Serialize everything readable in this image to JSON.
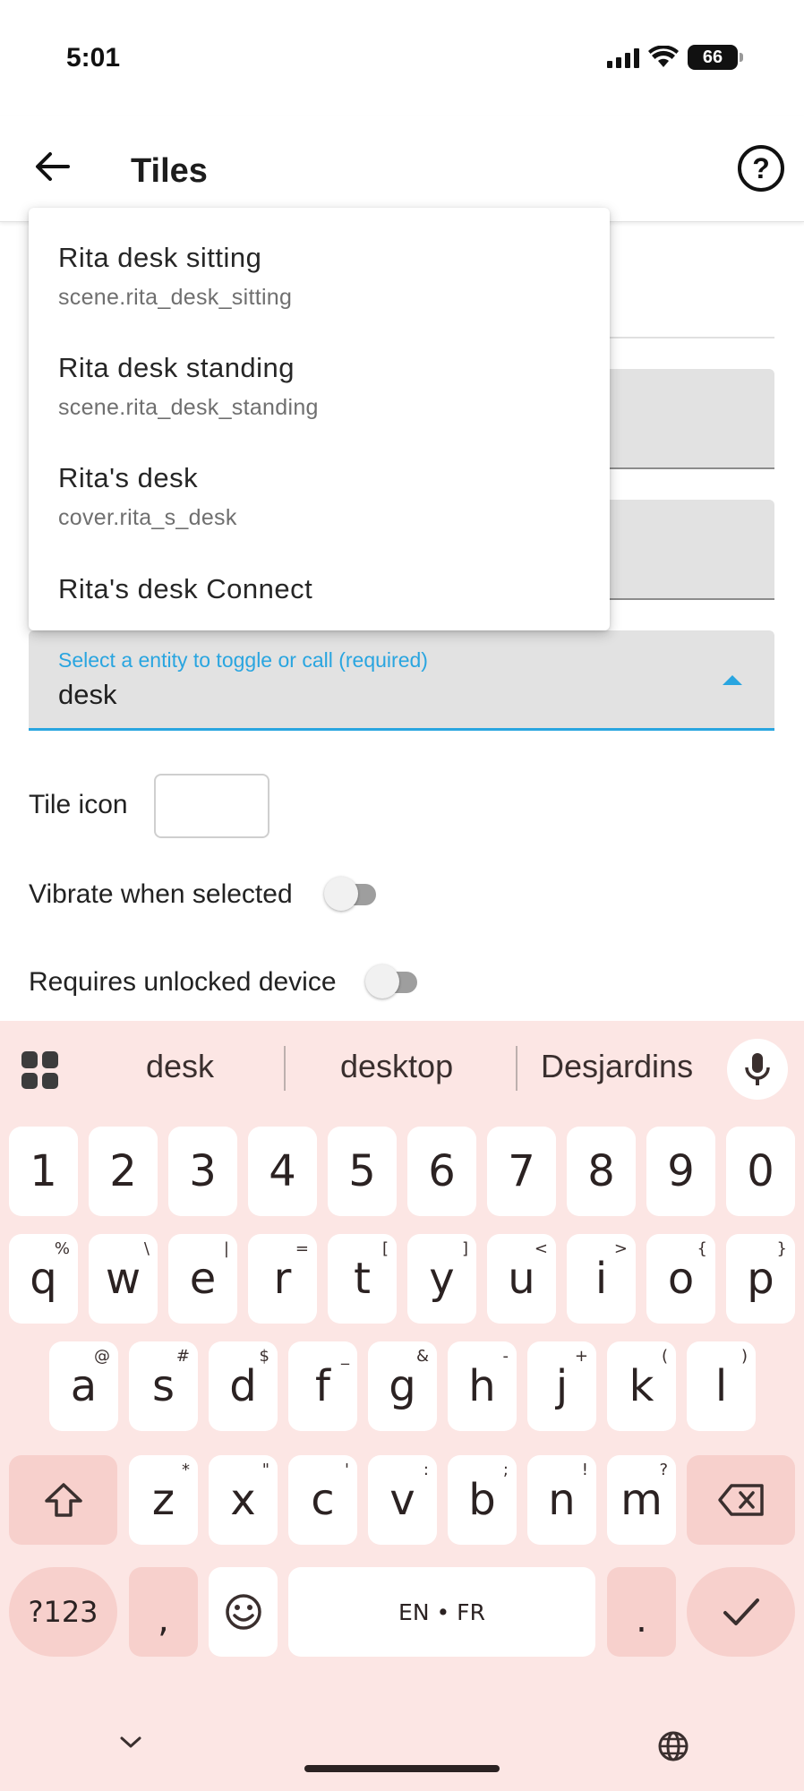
{
  "status_bar": {
    "time": "5:01",
    "battery": "66"
  },
  "app_bar": {
    "title": "Tiles"
  },
  "dropdown": {
    "items": [
      {
        "title": "Rita desk sitting",
        "subtitle": "scene.rita_desk_sitting"
      },
      {
        "title": "Rita desk standing",
        "subtitle": "scene.rita_desk_standing"
      },
      {
        "title": "Rita's desk",
        "subtitle": "cover.rita_s_desk"
      },
      {
        "title": "Rita's desk Connect"
      }
    ]
  },
  "entity_field": {
    "label": "Select a entity to toggle or call (required)",
    "value": "desk"
  },
  "tile_icon": {
    "label": "Tile icon"
  },
  "toggles": [
    {
      "label": "Vibrate when selected",
      "on": false
    },
    {
      "label": "Requires unlocked device",
      "on": false
    }
  ],
  "keyboard": {
    "suggestions": [
      "desk",
      "desktop",
      "Desjardins"
    ],
    "number_row": [
      "1",
      "2",
      "3",
      "4",
      "5",
      "6",
      "7",
      "8",
      "9",
      "0"
    ],
    "row1": [
      "q",
      "w",
      "e",
      "r",
      "t",
      "y",
      "u",
      "i",
      "o",
      "p"
    ],
    "row1_hints": [
      "%",
      "\\",
      "|",
      "=",
      "[",
      "]",
      "<",
      ">",
      "{",
      "}"
    ],
    "row2": [
      "a",
      "s",
      "d",
      "f",
      "g",
      "h",
      "j",
      "k",
      "l"
    ],
    "row2_hints": [
      "@",
      "#",
      "$",
      "_",
      "&",
      "-",
      "+",
      "(",
      ")"
    ],
    "row3": [
      "z",
      "x",
      "c",
      "v",
      "b",
      "n",
      "m"
    ],
    "row3_hints": [
      "*",
      "\"",
      "'",
      ":",
      ";",
      "!",
      "?"
    ],
    "symbols_key": "?123",
    "comma_key": ",",
    "space_label": "EN • FR",
    "period_key": "."
  }
}
